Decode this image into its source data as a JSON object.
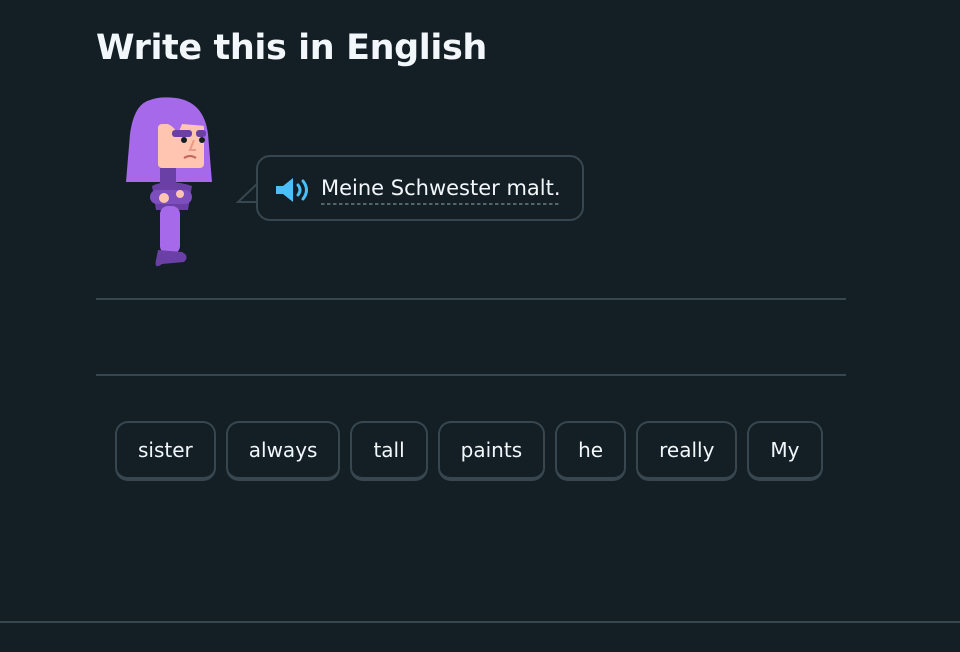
{
  "challenge": {
    "title": "Write this in English",
    "prompt_sentence": "Meine Schwester malt."
  },
  "character": {
    "icon": "lily-character-icon",
    "hair_color": "#a569ea",
    "skin_color": "#ffc5b1",
    "clothing_color": "#6a3fa6"
  },
  "audio": {
    "icon": "speaker-icon",
    "color": "#49c0f8"
  },
  "word_bank": [
    "sister",
    "always",
    "tall",
    "paints",
    "he",
    "really",
    "My"
  ],
  "theme": {
    "background": "#131f24",
    "border": "#37464f",
    "text": "#f1f7fb"
  }
}
